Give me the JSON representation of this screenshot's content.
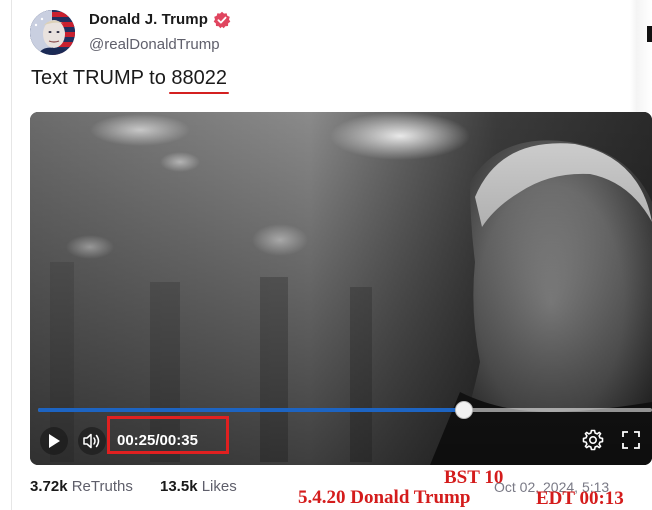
{
  "post": {
    "author_name": "Donald J. Trump",
    "handle": "@realDonaldTrump",
    "text_prefix": "Text TRUMP to ",
    "text_number": "88022",
    "verified_icon": "verified-badge-icon"
  },
  "video": {
    "current_time": "00:25",
    "separator": "/",
    "duration": "00:35",
    "progress_fraction": 0.71,
    "play_icon": "play-icon",
    "volume_icon": "volume-icon",
    "settings_icon": "gear-icon",
    "fullscreen_icon": "fullscreen-icon"
  },
  "stats": {
    "retruths_count": "3.72k",
    "retruths_label": "ReTruths",
    "likes_count": "13.5k",
    "likes_label": "Likes",
    "date": "Oct 02, 2024, 5:13"
  },
  "annotations": {
    "bst": "BST  10",
    "line": "5.4.20 Donald Trump",
    "edt": "EDT 00:13"
  },
  "colors": {
    "accent_blue": "#1d64c2",
    "verified_pink": "#e0455f",
    "annotation_red": "#d41c1c"
  }
}
